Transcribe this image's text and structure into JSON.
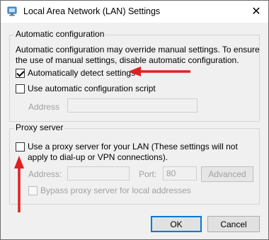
{
  "window": {
    "title": "Local Area Network (LAN) Settings",
    "close_symbol": "✕"
  },
  "auto_config": {
    "legend": "Automatic configuration",
    "description": "Automatic configuration may override manual settings.  To ensure the use of manual settings, disable automatic configuration.",
    "auto_detect": {
      "label": "Automatically detect settings",
      "checked": true
    },
    "use_script": {
      "label": "Use automatic configuration script",
      "checked": false
    },
    "address_label": "Address",
    "address_value": ""
  },
  "proxy": {
    "legend": "Proxy server",
    "use_proxy": {
      "label": "Use a proxy server for your LAN (These settings will not apply to dial-up or VPN connections).",
      "checked": false
    },
    "address_label": "Address:",
    "address_value": "",
    "port_label": "Port:",
    "port_value": "80",
    "advanced_label": "Advanced",
    "bypass": {
      "label": "Bypass proxy server for local addresses",
      "checked": false
    }
  },
  "buttons": {
    "ok_label": "OK",
    "cancel_label": "Cancel"
  },
  "annotations": {
    "arrow_color": "#e02020"
  },
  "icons": {
    "title_icon": "network-settings-icon",
    "close_icon": "close-icon"
  }
}
